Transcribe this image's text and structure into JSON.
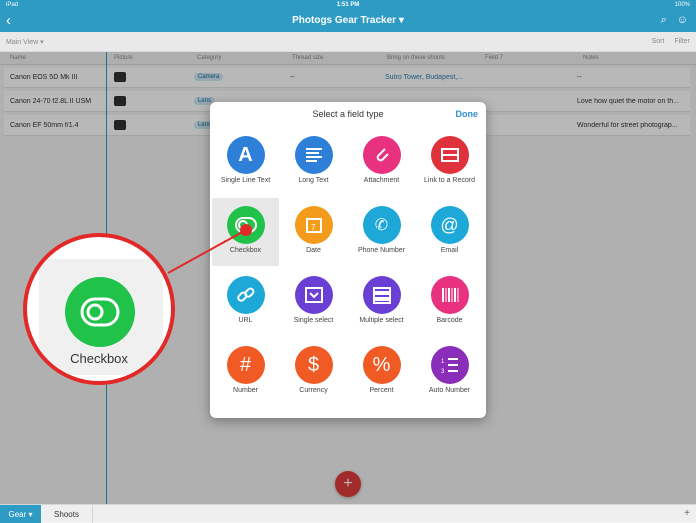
{
  "status": {
    "carrier": "iPad",
    "time": "1:51 PM",
    "battery": "100%"
  },
  "app": {
    "title": "Photogs Gear Tracker ▾"
  },
  "viewbar": {
    "view": "Main View ▾",
    "sort": "Sort",
    "filter": "Filter"
  },
  "columns": [
    "Name",
    "Picture",
    "Category",
    "Thread size",
    "Bring on these shoots",
    "Field 7",
    "Notes"
  ],
  "rows": [
    {
      "name": "Canon EOS 5D Mk III",
      "category": "Camera",
      "thread": "--",
      "shoots": "Sutro Tower, Budapest,...",
      "notes": "--"
    },
    {
      "name": "Canon 24-70 f2.8L II USM",
      "category": "Lens",
      "thread": "",
      "shoots": "",
      "notes": "Love how quiet the motor on th..."
    },
    {
      "name": "Canon EF 50mm f/1.4",
      "category": "Lens",
      "thread": "",
      "shoots": "",
      "notes": "Wonderful for street photograp..."
    }
  ],
  "modal": {
    "title": "Select a field type",
    "done": "Done"
  },
  "fields": [
    {
      "label": "Single Line Text",
      "color": "#2d7fd8",
      "icon": "letter-a-icon"
    },
    {
      "label": "Long Text",
      "color": "#2d7fd8",
      "icon": "paragraph-icon"
    },
    {
      "label": "Attachment",
      "color": "#e8317f",
      "icon": "paperclip-icon"
    },
    {
      "label": "Link to a Record",
      "color": "#e0323c",
      "icon": "link-record-icon"
    },
    {
      "label": "Checkbox",
      "color": "#21c24a",
      "icon": "checkbox-toggle-icon"
    },
    {
      "label": "Date",
      "color": "#f39c1b",
      "icon": "calendar-icon"
    },
    {
      "label": "Phone Number",
      "color": "#1da8d8",
      "icon": "phone-icon"
    },
    {
      "label": "Email",
      "color": "#1da8d8",
      "icon": "at-sign-icon"
    },
    {
      "label": "URL",
      "color": "#1da8d8",
      "icon": "chain-link-icon"
    },
    {
      "label": "Single select",
      "color": "#6a3fd4",
      "icon": "dropdown-icon"
    },
    {
      "label": "Multiple select",
      "color": "#6a3fd4",
      "icon": "stacked-list-icon"
    },
    {
      "label": "Barcode",
      "color": "#e8317f",
      "icon": "barcode-icon"
    },
    {
      "label": "Number",
      "color": "#f05a25",
      "icon": "hash-icon"
    },
    {
      "label": "Currency",
      "color": "#f05a25",
      "icon": "dollar-icon"
    },
    {
      "label": "Percent",
      "color": "#f05a25",
      "icon": "percent-icon"
    },
    {
      "label": "Auto Number",
      "color": "#8a2db8",
      "icon": "numbered-list-icon"
    }
  ],
  "zoom": {
    "label": "Checkbox"
  },
  "tabs": {
    "active": "Gear ▾",
    "other": "Shoots"
  }
}
